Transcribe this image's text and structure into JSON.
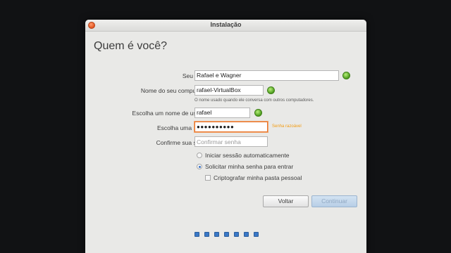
{
  "window": {
    "title": "Instalação"
  },
  "heading": "Quem é você?",
  "form": {
    "name_label": "Seu nome:",
    "name_value": "Rafael e Wagner",
    "computer_label": "Nome do seu computador:",
    "computer_value": "rafael-VirtualBox",
    "computer_hint": "O nome usado quando ele conversa com outros computadores.",
    "username_label": "Escolha um nome de usuário:",
    "username_value": "rafael",
    "password_label": "Escolha uma senha:",
    "password_value": "●●●●●●●●●●",
    "password_strength": "Senha razoável",
    "confirm_label": "Confirme sua senha:",
    "confirm_placeholder": "Confirmar senha"
  },
  "options": {
    "auto_login": "Iniciar sessão automaticamente",
    "require_password": "Solicitar minha senha para entrar",
    "encrypt_home": "Criptografar minha pasta pessoal",
    "selected": "require_password",
    "encrypt_checked": false
  },
  "buttons": {
    "back": "Voltar",
    "continue": "Continuar"
  },
  "colors": {
    "accent": "#3a78c6",
    "ok": "#4c9c1d",
    "focus": "#e8742c",
    "warning": "#f39c12"
  },
  "progress": {
    "steps": 7
  }
}
